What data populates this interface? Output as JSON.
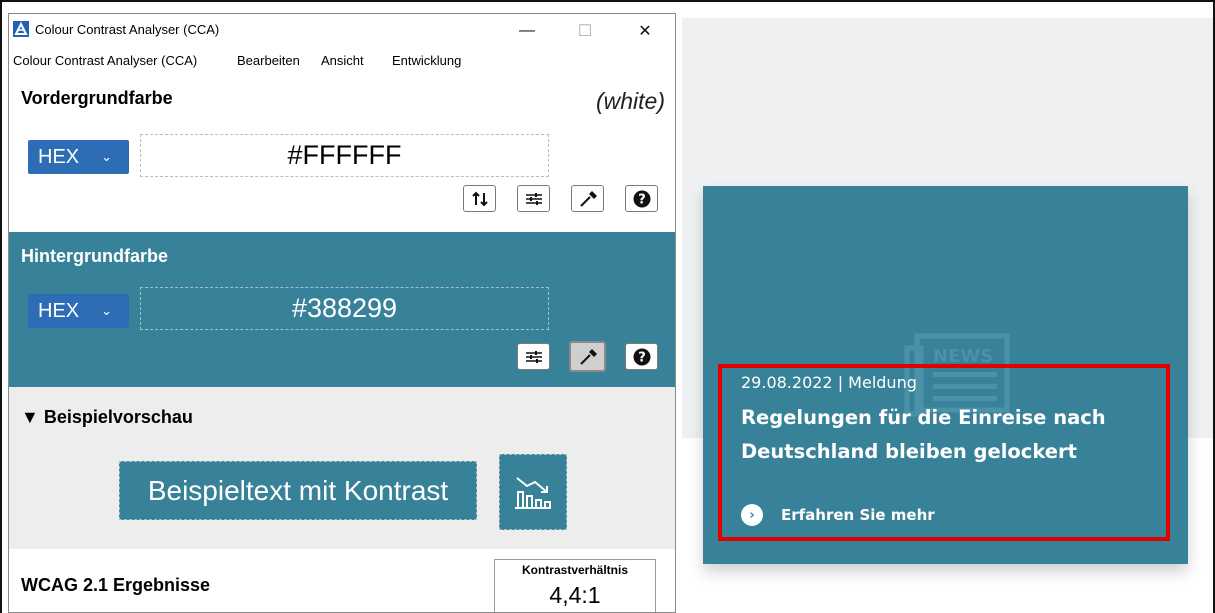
{
  "window": {
    "title": "Colour Contrast Analyser (CCA)",
    "minimize_glyph": "—",
    "maximize_glyph": "☐",
    "close_glyph": "✕"
  },
  "menu": [
    "Colour Contrast Analyser (CCA)",
    "Bearbeiten",
    "Ansicht",
    "Entwicklung"
  ],
  "foreground": {
    "title": "Vordergrundfarbe",
    "name_hint": "(white)",
    "format": "HEX",
    "value": "#FFFFFF",
    "buttons": [
      "swap-icon",
      "sliders-icon",
      "eyedropper-icon",
      "help-icon"
    ]
  },
  "background": {
    "title": "Hintergrundfarbe",
    "format": "HEX",
    "value": "#388299",
    "buttons": [
      "sliders-icon",
      "eyedropper-icon",
      "help-icon"
    ]
  },
  "preview": {
    "title": "▼ Beispielvorschau",
    "sample_text": "Beispieltext mit Kontrast"
  },
  "results": {
    "title": "WCAG 2.1 Ergebnisse",
    "ratio_label": "Kontrastverhältnis",
    "ratio_value": "4,4:1"
  },
  "web_news": {
    "illustration_label": "NEWS",
    "date": "29.08.2022 | Meldung",
    "headline_line1": "Regelungen für die Einreise nach",
    "headline_line2": "Deutschland bleiben gelockert",
    "link": "Erfahren Sie mehr"
  },
  "colors": {
    "teal": "#388299",
    "select_blue": "#2c6db5",
    "highlight_red": "#e00000",
    "page_bg": "#eef0f2"
  }
}
